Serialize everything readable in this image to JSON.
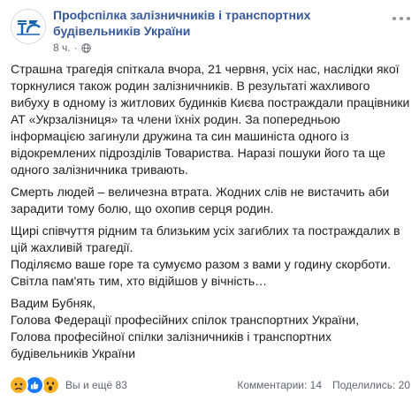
{
  "post": {
    "page_name": "Профспілка залізничників і транспортних будівельників України",
    "time": "8 ч.",
    "dot": "·",
    "paragraphs": [
      "Страшна трагедія спіткала вчора, 21 червня, усіх нас, наслідки якої торкнулися також родин залізничників. В результаті жахливого вибуху в одному із житлових будинків Києва постраждали працівники АТ «Укрзалізниця» та члени їхніх родин. За попередньою інформацією загинули дружина та син машиніста одного із відокремлених підрозділів Товариства. Наразі пошуки його та ще одного залізничника тривають.",
      "Смерть людей – величезна втрата. Жодних слів не вистачить аби зарадити тому болю, що охопив серця родин.",
      "Щирі співчуття рідним та близьким усіх загиблих та постраждалих в цій жахливій трагедії.",
      "Поділяємо ваше горе та сумуємо разом з вами у годину скорботи.",
      "Світла пам'ять тим, хто відійшов у вічність…",
      "Вадим Бубняк,",
      "Голова Федерації професійних спілок транспортних України,",
      "Голова професійної спілки залізничників і транспортних будівельників України"
    ]
  },
  "footer": {
    "reactions_label": "Вы и ещё 83",
    "comments": "Комментарии: 14",
    "shares": "Поделились: 20",
    "reaction_icons": [
      "sad-reaction-icon",
      "like-reaction-icon",
      "wow-reaction-icon"
    ]
  },
  "colors": {
    "link": "#385898",
    "meta": "#616770",
    "like": "#1877f2",
    "emoji": "#f7b125"
  }
}
